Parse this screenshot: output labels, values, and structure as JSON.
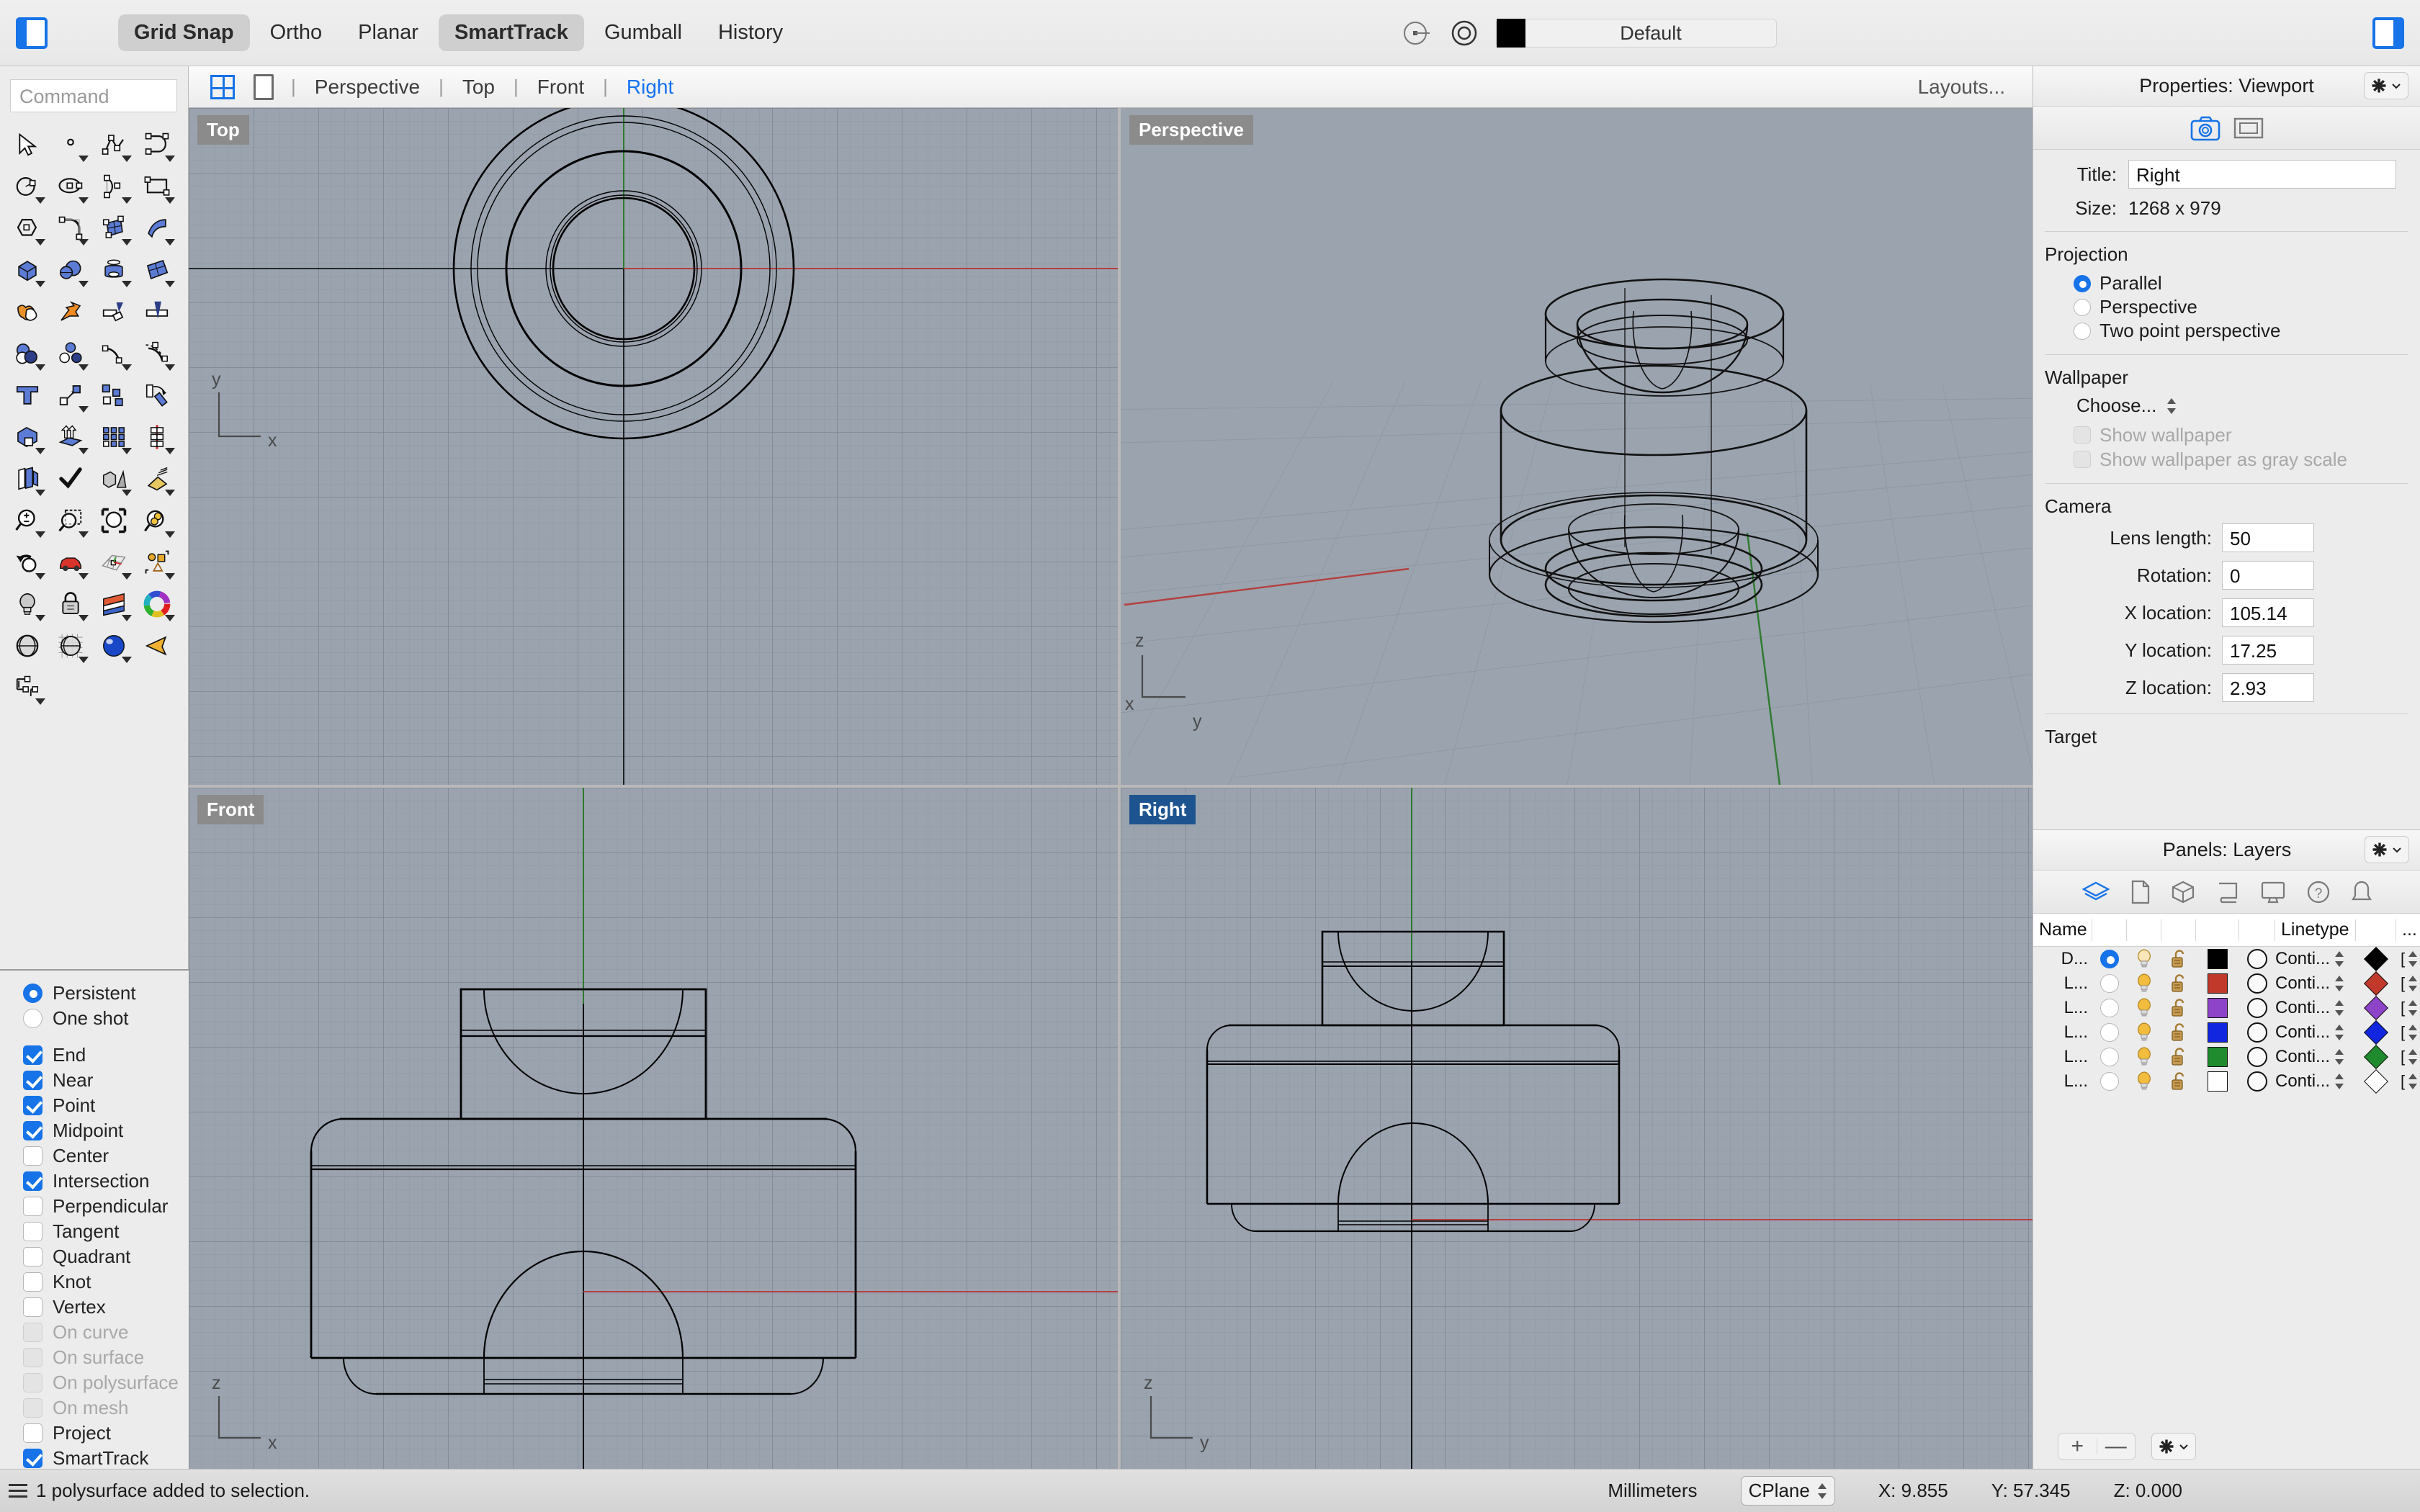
{
  "toolbar": {
    "left_panel_toggle": "left-panel-toggle",
    "right_panel_toggle": "right-panel-toggle",
    "modes": [
      {
        "label": "Grid Snap",
        "active": true
      },
      {
        "label": "Ortho",
        "active": false
      },
      {
        "label": "Planar",
        "active": false
      },
      {
        "label": "SmartTrack",
        "active": true
      },
      {
        "label": "Gumball",
        "active": false
      },
      {
        "label": "History",
        "active": false
      }
    ],
    "layer_color": "#000000",
    "default_layer_label": "Default"
  },
  "viewport_tabs": {
    "items": [
      {
        "label": "Perspective",
        "active": false
      },
      {
        "label": "Top",
        "active": false
      },
      {
        "label": "Front",
        "active": false
      },
      {
        "label": "Right",
        "active": true
      }
    ],
    "layouts_label": "Layouts..."
  },
  "command": {
    "placeholder": "Command",
    "value": ""
  },
  "tools": [
    "select-arrow-icon",
    "point-icon",
    "polyline-icon",
    "curve-icon",
    "circle-icon",
    "ellipse-icon",
    "arc-icon",
    "rectangle-icon",
    "polygon-icon",
    "fillet-curve-icon",
    "surface-from-curves-icon",
    "sweep-surface-icon",
    "box-icon",
    "sphere-icon",
    "tube-icon",
    "surface-patch-icon",
    "boolean-union-icon",
    "explode-icon",
    "split-icon",
    "trim-icon",
    "boolean-difference-icon",
    "boolean-intersection-icon",
    "offset-curve-icon",
    "offset-dashed-icon",
    "text-icon",
    "move-icon",
    "scatter-copy-icon",
    "rotate-icon",
    "solid-tools-icon",
    "extrude-icon",
    "array-icon",
    "mirror-icon",
    "unroll-icon",
    "check-icon",
    "shapes-icon",
    "paint-icon",
    "zoom-in-out-icon",
    "zoom-window-icon",
    "zoom-extents-icon",
    "zoom-selected-icon",
    "undo-view-icon",
    "car-icon",
    "cplane-icon",
    "select-objects-icon",
    "light-icon",
    "lock-icon",
    "flag-surface-icon",
    "color-wheel-icon",
    "shaded-sphere-icon",
    "ghosted-sphere-icon",
    "rendered-sphere-icon",
    "camera-icon",
    "dimension-icon"
  ],
  "osnap": {
    "mode": [
      {
        "label": "Persistent",
        "checked": true
      },
      {
        "label": "One shot",
        "checked": false
      }
    ],
    "snaps": [
      {
        "label": "End",
        "checked": true,
        "disabled": false
      },
      {
        "label": "Near",
        "checked": true,
        "disabled": false
      },
      {
        "label": "Point",
        "checked": true,
        "disabled": false
      },
      {
        "label": "Midpoint",
        "checked": true,
        "disabled": false
      },
      {
        "label": "Center",
        "checked": false,
        "disabled": false
      },
      {
        "label": "Intersection",
        "checked": true,
        "disabled": false
      },
      {
        "label": "Perpendicular",
        "checked": false,
        "disabled": false
      },
      {
        "label": "Tangent",
        "checked": false,
        "disabled": false
      },
      {
        "label": "Quadrant",
        "checked": false,
        "disabled": false
      },
      {
        "label": "Knot",
        "checked": false,
        "disabled": false
      },
      {
        "label": "Vertex",
        "checked": false,
        "disabled": false
      },
      {
        "label": "On curve",
        "checked": false,
        "disabled": true
      },
      {
        "label": "On surface",
        "checked": false,
        "disabled": true
      },
      {
        "label": "On polysurface",
        "checked": false,
        "disabled": true
      },
      {
        "label": "On mesh",
        "checked": false,
        "disabled": true
      },
      {
        "label": "Project",
        "checked": false,
        "disabled": false
      },
      {
        "label": "SmartTrack",
        "checked": true,
        "disabled": false
      }
    ]
  },
  "viewports": [
    {
      "name": "Top",
      "active": false,
      "axes": [
        "y",
        "x"
      ]
    },
    {
      "name": "Perspective",
      "active": false,
      "axes": [
        "z",
        "x",
        "y"
      ]
    },
    {
      "name": "Front",
      "active": false,
      "axes": [
        "z",
        "x"
      ]
    },
    {
      "name": "Right",
      "active": true,
      "axes": [
        "z",
        "y"
      ]
    }
  ],
  "properties": {
    "panel_title": "Properties: Viewport",
    "tabs": [
      "camera-icon",
      "viewport-icon"
    ],
    "title_label": "Title:",
    "title_value": "Right",
    "size_label": "Size:",
    "size_value": "1268 x 979",
    "projection_label": "Projection",
    "projection_options": [
      {
        "label": "Parallel",
        "checked": true
      },
      {
        "label": "Perspective",
        "checked": false
      },
      {
        "label": "Two point perspective",
        "checked": false
      }
    ],
    "wallpaper_label": "Wallpaper",
    "wallpaper_choose": "Choose...",
    "wallpaper_checks": [
      {
        "label": "Show wallpaper",
        "checked": false,
        "disabled": true
      },
      {
        "label": "Show wallpaper as gray scale",
        "checked": false,
        "disabled": true
      }
    ],
    "camera_label": "Camera",
    "camera_fields": [
      {
        "label": "Lens length:",
        "value": "50"
      },
      {
        "label": "Rotation:",
        "value": "0"
      },
      {
        "label": "X location:",
        "value": "105.14"
      },
      {
        "label": "Y location:",
        "value": "17.25"
      },
      {
        "label": "Z location:",
        "value": "2.93"
      }
    ],
    "target_label": "Target"
  },
  "layers": {
    "panel_title": "Panels: Layers",
    "tab_icons": [
      "layers-icon",
      "document-icon",
      "object-icon",
      "scroll-icon",
      "display-icon",
      "help-icon",
      "notification-icon"
    ],
    "columns": [
      "Name",
      "Linetype",
      "..."
    ],
    "rows": [
      {
        "name": "D...",
        "current": true,
        "on": true,
        "locked": false,
        "color": "#000000",
        "linetype": "Conti...",
        "print_color": "#000000"
      },
      {
        "name": "L...",
        "current": false,
        "on": true,
        "locked": false,
        "color": "#c0392b",
        "linetype": "Conti...",
        "print_color": "#c0392b"
      },
      {
        "name": "L...",
        "current": false,
        "on": true,
        "locked": false,
        "color": "#8e44c8",
        "linetype": "Conti...",
        "print_color": "#8e44c8"
      },
      {
        "name": "L...",
        "current": false,
        "on": true,
        "locked": false,
        "color": "#1226e0",
        "linetype": "Conti...",
        "print_color": "#1226e0"
      },
      {
        "name": "L...",
        "current": false,
        "on": true,
        "locked": false,
        "color": "#1f8b2e",
        "linetype": "Conti...",
        "print_color": "#1f8b2e"
      },
      {
        "name": "L...",
        "current": false,
        "on": true,
        "locked": false,
        "color": "#ffffff",
        "linetype": "Conti...",
        "print_color": "#ffffff"
      }
    ],
    "footer": {
      "add": "+",
      "remove": "—"
    }
  },
  "status": {
    "message": "1 polysurface added to selection.",
    "units": "Millimeters",
    "cplane": "CPlane",
    "x": "X: 9.855",
    "y": "Y: 57.345",
    "z": "Z: 0.000"
  },
  "colors": {
    "accent": "#1673e8",
    "viewport_bg": "#9aa3ae",
    "active_label_bg": "#1d5490",
    "axis_red": "#b44040",
    "axis_green": "#2f7a2f"
  }
}
